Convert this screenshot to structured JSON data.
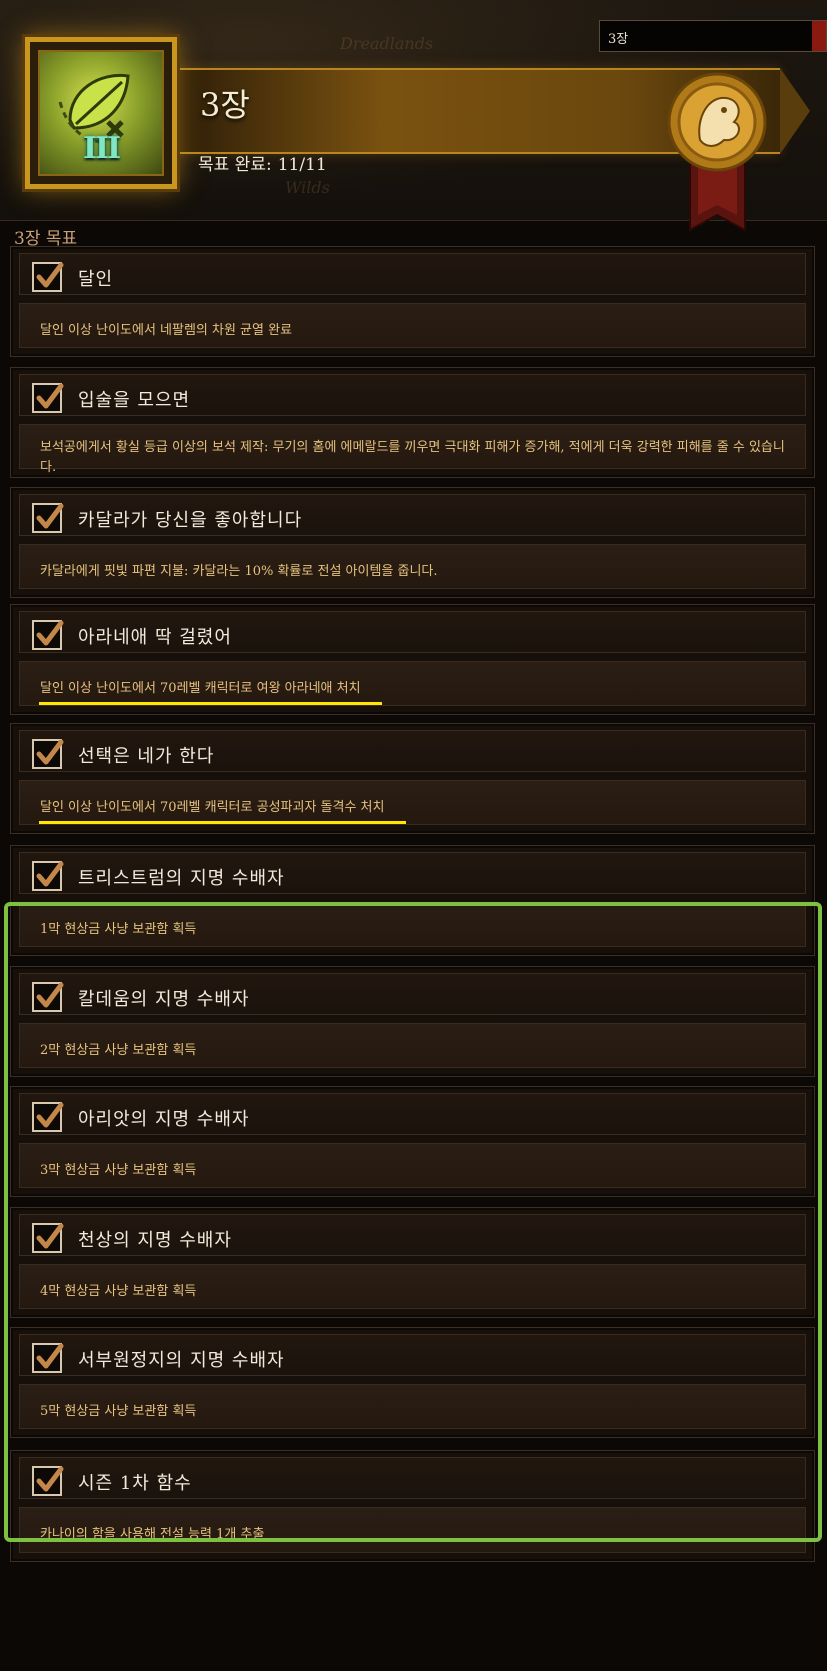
{
  "header": {
    "chapter_select_value": "3장",
    "chapter_title": "3장",
    "progress_label": "목표 완료:",
    "progress_value": "11/11",
    "chapter_roman": "III",
    "map_labels": [
      "Dreadlands",
      "Wilds"
    ]
  },
  "section_heading": "3장 목표",
  "objectives": [
    {
      "title": "달인",
      "desc": "달인 이상 난이도에서 네팔렘의 차원 균열 완료",
      "completed": true,
      "highlight": false
    },
    {
      "title": "입술을 모으면",
      "desc": "보석공에게서 황실 등급 이상의 보석 제작: 무기의 홈에 에메랄드를 끼우면 극대화 피해가 증가해, 적에게 더욱 강력한 피해를 줄 수 있습니다.",
      "completed": true,
      "highlight": false
    },
    {
      "title": "카달라가 당신을 좋아합니다",
      "desc": "카달라에게 핏빛 파편 지불: 카달라는 10% 확률로 전설 아이템을 줍니다.",
      "completed": true,
      "highlight": false
    },
    {
      "title": "아라네애 딱 걸렸어",
      "desc": "달인 이상 난이도에서 70레벨 캐릭터로 여왕 아라네애 처치",
      "completed": true,
      "highlight": true
    },
    {
      "title": "선택은 네가 한다",
      "desc": "달인 이상 난이도에서 70레벨 캐릭터로 공성파괴자 돌격수 처치",
      "completed": true,
      "highlight": true
    },
    {
      "title": "트리스트럼의 지명 수배자",
      "desc": "1막 현상금 사냥 보관함 획득",
      "completed": true,
      "highlight": false
    },
    {
      "title": "칼데움의 지명 수배자",
      "desc": "2막 현상금 사냥 보관함 획득",
      "completed": true,
      "highlight": false
    },
    {
      "title": "아리앗의 지명 수배자",
      "desc": "3막 현상금 사냥 보관함 획득",
      "completed": true,
      "highlight": false
    },
    {
      "title": "천상의 지명 수배자",
      "desc": "4막 현상금 사냥 보관함 획득",
      "completed": true,
      "highlight": false
    },
    {
      "title": "서부원정지의 지명 수배자",
      "desc": "5막 현상금 사냥 보관함 획득",
      "completed": true,
      "highlight": false
    },
    {
      "title": "시즌 1차 함수",
      "desc": "카나이의 함을 사용해 전설 능력 1개 추출",
      "completed": true,
      "highlight": false
    }
  ],
  "colors": {
    "accent_gold": "#c9971e",
    "highlight_underline": "#ffe600",
    "group_frame": "#7ec040",
    "desc_text": "#e6c27e"
  },
  "icons": [
    "chapter-map-icon",
    "faction-medal-icon",
    "checkmark-icon"
  ]
}
